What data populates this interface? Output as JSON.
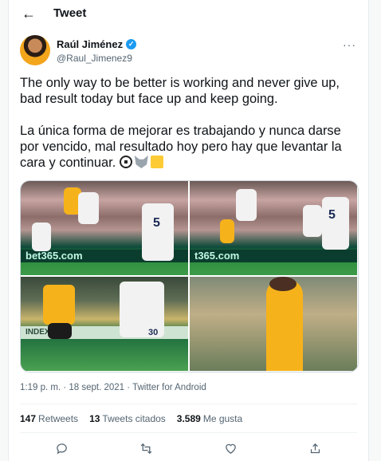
{
  "header": {
    "back_icon": "arrow-left-icon",
    "title": "Tweet"
  },
  "author": {
    "name": "Raúl Jiménez",
    "handle": "@Raul_Jimenez9",
    "verified": true,
    "more_icon": "more-dots-icon"
  },
  "tweet": {
    "paragraph1": "The only way to be better is working and never give up, bad result today but face up and keep going.",
    "paragraph2": "La única forma de mejorar es trabajando y nunca darse por vencido, mal resultado hoy pero hay que levantar la cara y continuar.",
    "emojis": [
      "soccer-ball-icon",
      "wolf-icon",
      "yellow-square-icon"
    ]
  },
  "media": {
    "photo1_board": "bet365.com",
    "photo1_number": "5",
    "photo2_board": "t365.com",
    "photo2_number": "5",
    "photo3_number": "30",
    "photo3_board": "INDEX"
  },
  "meta": {
    "time": "1:19 p. m.",
    "date": "18 sept. 2021",
    "source": "Twitter for Android",
    "separator": " · "
  },
  "stats": {
    "retweets_count": "147",
    "retweets_label": "Retweets",
    "quotes_count": "13",
    "quotes_label": "Tweets citados",
    "likes_count": "3.589",
    "likes_label": "Me gusta"
  },
  "actions": [
    "reply-icon",
    "retweet-icon",
    "like-icon",
    "share-icon"
  ],
  "colors": {
    "accent": "#1d9bf0",
    "text": "#0f1419",
    "muted": "#536471"
  }
}
